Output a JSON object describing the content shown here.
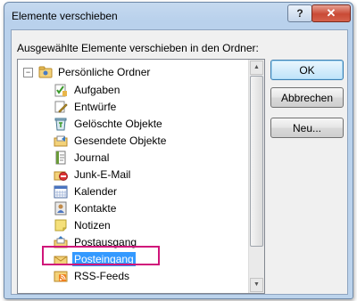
{
  "dialog": {
    "title": "Elemente verschieben",
    "help_label": "?",
    "close_label": "✕",
    "prompt": "Ausgewählte Elemente verschieben in den Ordner:"
  },
  "tree": {
    "root_label": "Persönliche Ordner",
    "items": [
      {
        "label": "Aufgaben",
        "icon": "tasks-icon"
      },
      {
        "label": "Entwürfe",
        "icon": "drafts-icon"
      },
      {
        "label": "Gelöschte Objekte",
        "icon": "deleted-items-icon"
      },
      {
        "label": "Gesendete Objekte",
        "icon": "sent-items-icon"
      },
      {
        "label": "Journal",
        "icon": "journal-icon"
      },
      {
        "label": "Junk-E-Mail",
        "icon": "junk-mail-icon"
      },
      {
        "label": "Kalender",
        "icon": "calendar-icon"
      },
      {
        "label": "Kontakte",
        "icon": "contacts-icon"
      },
      {
        "label": "Notizen",
        "icon": "notes-icon"
      },
      {
        "label": "Postausgang",
        "icon": "outbox-icon"
      },
      {
        "label": "Posteingang",
        "icon": "inbox-icon",
        "selected": true
      },
      {
        "label": "RSS-Feeds",
        "icon": "rss-icon"
      }
    ]
  },
  "buttons": {
    "ok": "OK",
    "cancel": "Abbrechen",
    "new": "Neu..."
  }
}
